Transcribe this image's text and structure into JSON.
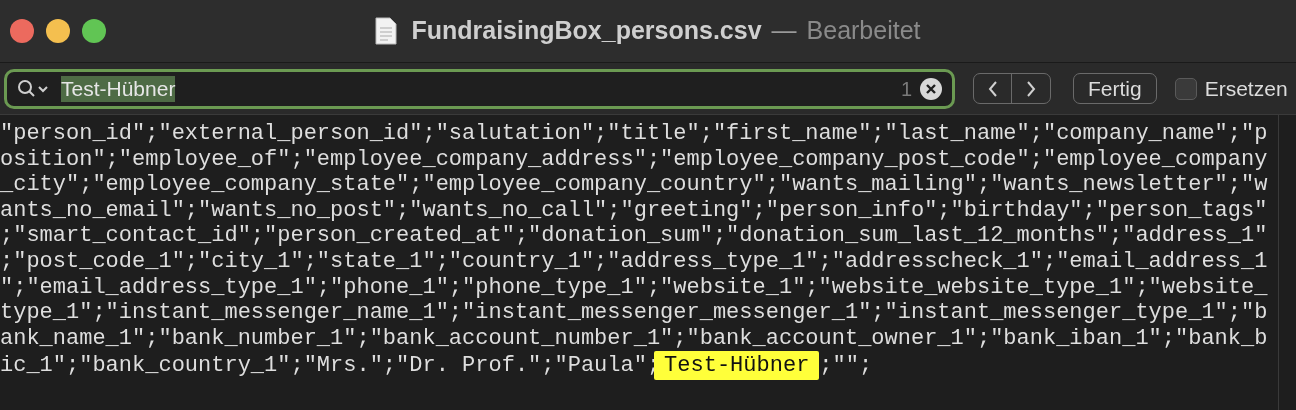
{
  "window": {
    "title": "FundraisingBox_persons.csv",
    "separator": "—",
    "status": "Bearbeitet"
  },
  "find_bar": {
    "query": "Test-Hübner",
    "match_count": "1",
    "done_button": "Fertig",
    "replace": {
      "label": "Ersetzen",
      "checked": false
    }
  },
  "text_lines": [
    "\"person_id\";\"external_person_id\";\"salutation\";\"title\";\"first_name\";\"last_name\";\"company_name\";\"p",
    "osition\";\"employee_of\";\"employee_company_address\";\"employee_company_post_code\";\"employee_company",
    "_city\";\"employee_company_state\";\"employee_company_country\";\"wants_mailing\";\"wants_newsletter\";\"w",
    "ants_no_email\";\"wants_no_post\";\"wants_no_call\";\"greeting\";\"person_info\";\"birthday\";\"person_tags\"",
    ";\"smart_contact_id\";\"person_created_at\";\"donation_sum\";\"donation_sum_last_12_months\";\"address_1\"",
    ";\"post_code_1\";\"city_1\";\"state_1\";\"country_1\";\"address_type_1\";\"addresscheck_1\";\"email_address_1",
    "\";\"email_address_type_1\";\"phone_1\";\"phone_type_1\";\"website_1\";\"website_website_type_1\";\"website_",
    "type_1\";\"instant_messenger_name_1\";\"instant_messenger_messenger_1\";\"instant_messenger_type_1\";\"b",
    "ank_name_1\";\"bank_number_1\";\"bank_account_number_1\";\"bank_account_owner_1\";\"bank_iban_1\";\"bank_b"
  ],
  "last_line": {
    "before": "ic_1\";\"bank_country_1\";\"Mrs.\";\"Dr. Prof.\";\"Paula\";",
    "match": "Test-Hübner",
    "after": ";\"\";"
  }
}
